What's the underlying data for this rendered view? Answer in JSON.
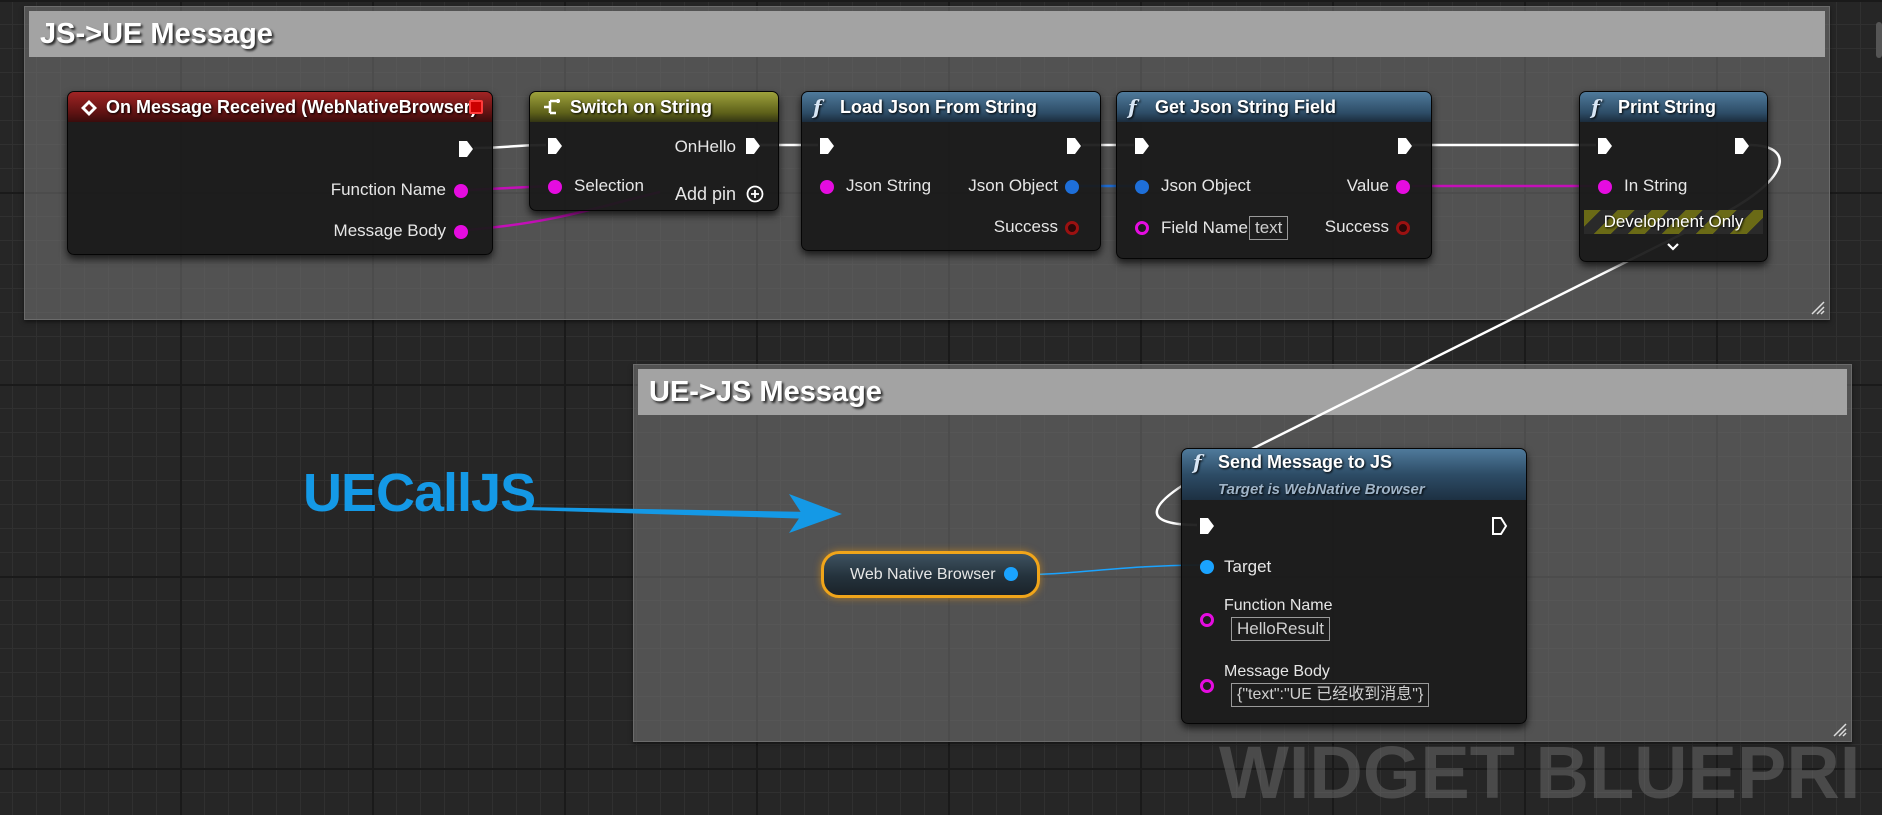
{
  "comments": {
    "js_to_ue": "JS->UE Message",
    "ue_to_js": "UE->JS Message"
  },
  "annotation": "UECallJS",
  "watermark": "WIDGET BLUEPRI",
  "nodes": {
    "on_message": {
      "title": "On Message Received (WebNativeBrowser)",
      "pins": {
        "function_name": "Function Name",
        "message_body": "Message Body"
      }
    },
    "switch": {
      "title": "Switch on String",
      "pins": {
        "selection": "Selection",
        "on_hello": "OnHello",
        "add_pin": "Add pin"
      }
    },
    "load_json": {
      "title": "Load Json From String",
      "pins": {
        "json_string": "Json String",
        "json_object": "Json Object",
        "success": "Success"
      }
    },
    "get_field": {
      "title": "Get Json String Field",
      "pins": {
        "json_object": "Json Object",
        "field_name": "Field Name",
        "field_value": "text",
        "value": "Value",
        "success": "Success"
      }
    },
    "print_string": {
      "title": "Print String",
      "pins": {
        "in_string": "In String"
      },
      "dev_only": "Development Only"
    },
    "send_message": {
      "title": "Send Message to JS",
      "subtitle": "Target is WebNative Browser",
      "pins": {
        "target": "Target",
        "function_name": "Function Name",
        "function_name_value": "HelloResult",
        "message_body": "Message Body",
        "message_body_value": "{\"text\":\"UE 已经收到消息\"}"
      }
    },
    "web_browser_var": {
      "label": "Web Native Browser"
    }
  },
  "icons": {
    "event": "event-diamond-icon",
    "switch": "switch-icon",
    "function": "function-f-icon",
    "add": "add-pin-plus-icon",
    "expand": "chevron-down-icon"
  },
  "colors": {
    "exec": "#ffffff",
    "string_pin": "#e50ce0",
    "object_pin": "#1aa3ff",
    "bool_pin": "#9b1111",
    "annotation": "#1499e6",
    "highlight": "#f0a51a"
  }
}
